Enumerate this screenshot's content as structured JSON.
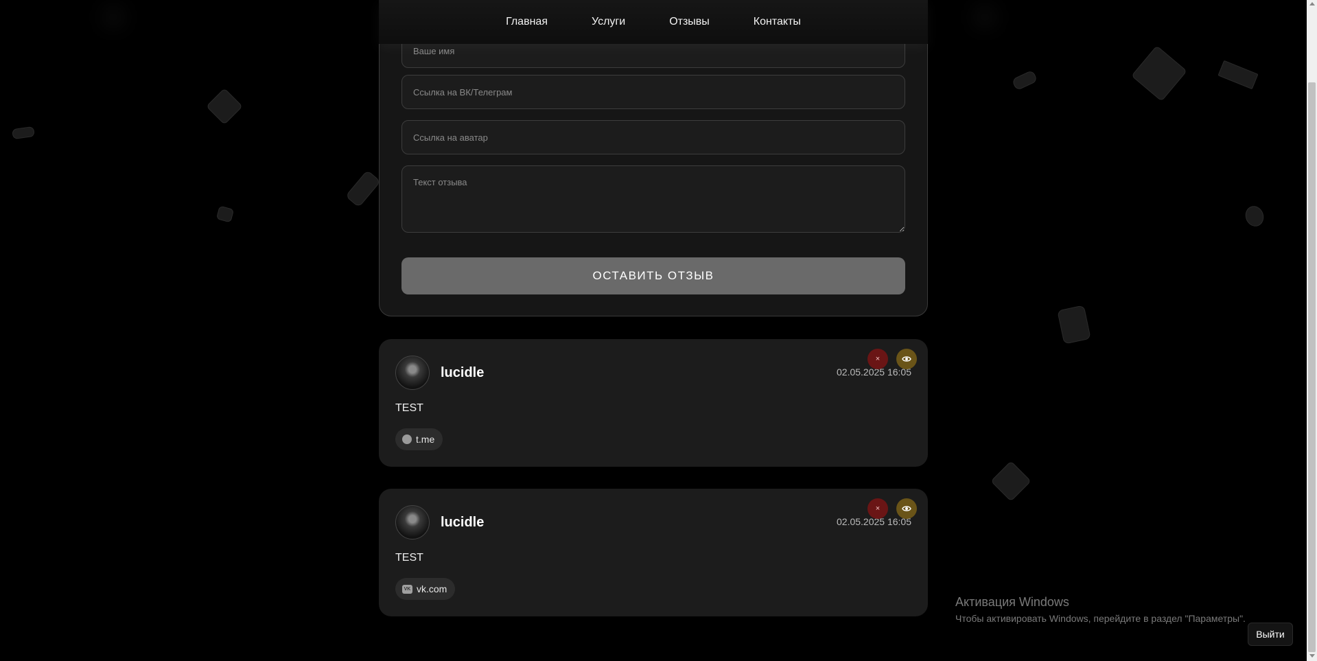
{
  "nav": {
    "items": [
      {
        "label": "Главная"
      },
      {
        "label": "Услуги"
      },
      {
        "label": "Отзывы"
      },
      {
        "label": "Контакты"
      }
    ]
  },
  "form": {
    "name_placeholder": "Ваше имя",
    "link_placeholder": "Ссылка на ВК/Телеграм",
    "avatar_placeholder": "Ссылка на аватар",
    "text_placeholder": "Текст отзыва",
    "submit_label": "ОСТАВИТЬ ОТЗЫВ"
  },
  "reviews": [
    {
      "name": "lucidle",
      "date": "02.05.2025 16:05",
      "text": "TEST",
      "link_label": "t.me",
      "link_icon": "telegram-icon",
      "delete_label": "×"
    },
    {
      "name": "lucidle",
      "date": "02.05.2025 16:05",
      "text": "TEST",
      "link_label": "vk.com",
      "link_icon": "vk-icon",
      "delete_label": "×"
    }
  ],
  "watermark": {
    "title": "Активация Windows",
    "subtitle": "Чтобы активировать Windows, перейдите в раздел \"Параметры\"."
  },
  "logout_label": "Выйти",
  "colors": {
    "background": "#000000",
    "card": "#1c1c1c",
    "delete": "#6a1515",
    "view": "#6a5418",
    "submit": "#6a6a6a"
  }
}
